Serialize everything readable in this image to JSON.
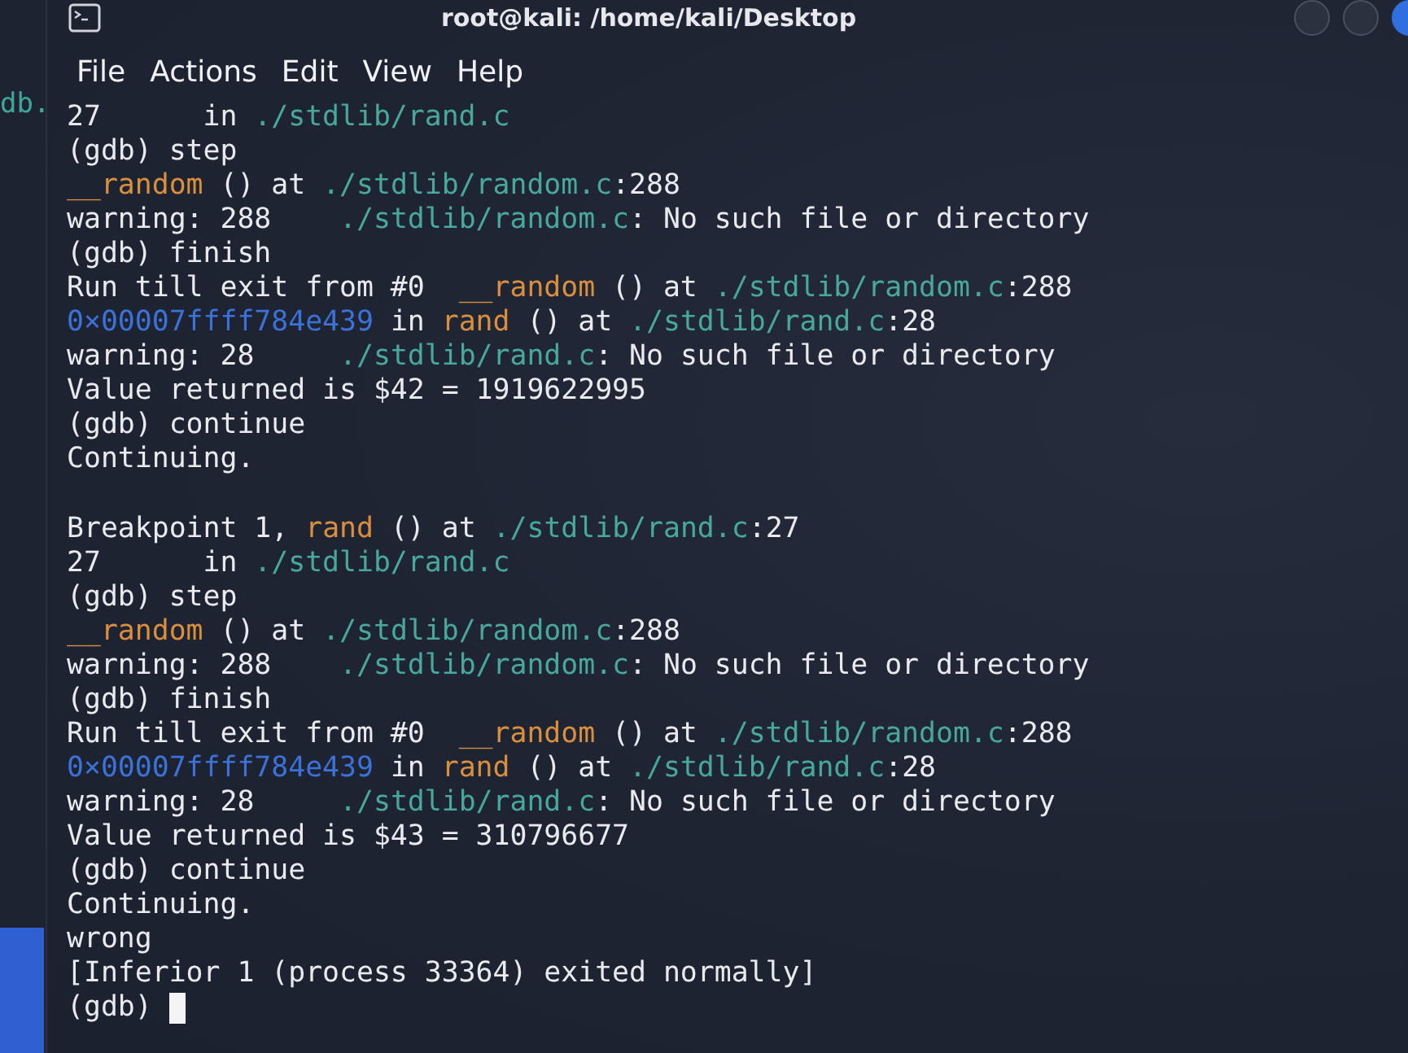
{
  "window": {
    "title": "root@kali: /home/kali/Desktop"
  },
  "background_window": {
    "text": "db."
  },
  "menu": [
    "File",
    "Actions",
    "Edit",
    "View",
    "Help"
  ],
  "terminal": {
    "lines": [
      {
        "kind": "output",
        "segments": [
          {
            "kind": "text",
            "text": "27      in "
          },
          {
            "kind": "path",
            "text": "./stdlib/rand.c"
          }
        ]
      },
      {
        "kind": "output",
        "segments": [
          {
            "kind": "text",
            "text": "(gdb) step"
          }
        ]
      },
      {
        "kind": "output",
        "segments": [
          {
            "kind": "func",
            "text": "__random"
          },
          {
            "kind": "text",
            "text": " () at "
          },
          {
            "kind": "path",
            "text": "./stdlib/random.c"
          },
          {
            "kind": "text",
            "text": ":288"
          }
        ]
      },
      {
        "kind": "output",
        "segments": [
          {
            "kind": "text",
            "text": "warning: 288    "
          },
          {
            "kind": "path",
            "text": "./stdlib/random.c"
          },
          {
            "kind": "text",
            "text": ": No such file or directory"
          }
        ]
      },
      {
        "kind": "output",
        "segments": [
          {
            "kind": "text",
            "text": "(gdb) finish"
          }
        ]
      },
      {
        "kind": "output",
        "segments": [
          {
            "kind": "text",
            "text": "Run till exit from #0  "
          },
          {
            "kind": "func",
            "text": "__random"
          },
          {
            "kind": "text",
            "text": " () at "
          },
          {
            "kind": "path",
            "text": "./stdlib/random.c"
          },
          {
            "kind": "text",
            "text": ":288"
          }
        ]
      },
      {
        "kind": "output",
        "segments": [
          {
            "kind": "addr",
            "text": "0×00007ffff784e439"
          },
          {
            "kind": "text",
            "text": " in "
          },
          {
            "kind": "func",
            "text": "rand"
          },
          {
            "kind": "text",
            "text": " () at "
          },
          {
            "kind": "path",
            "text": "./stdlib/rand.c"
          },
          {
            "kind": "text",
            "text": ":28"
          }
        ]
      },
      {
        "kind": "output",
        "segments": [
          {
            "kind": "text",
            "text": "warning: 28     "
          },
          {
            "kind": "path",
            "text": "./stdlib/rand.c"
          },
          {
            "kind": "text",
            "text": ": No such file or directory"
          }
        ]
      },
      {
        "kind": "output",
        "segments": [
          {
            "kind": "text",
            "text": "Value returned is $42 = 1919622995"
          }
        ]
      },
      {
        "kind": "output",
        "segments": [
          {
            "kind": "text",
            "text": "(gdb) continue"
          }
        ]
      },
      {
        "kind": "output",
        "segments": [
          {
            "kind": "text",
            "text": "Continuing."
          }
        ]
      },
      {
        "kind": "blank"
      },
      {
        "kind": "output",
        "segments": [
          {
            "kind": "text",
            "text": "Breakpoint 1, "
          },
          {
            "kind": "func",
            "text": "rand"
          },
          {
            "kind": "text",
            "text": " () at "
          },
          {
            "kind": "path",
            "text": "./stdlib/rand.c"
          },
          {
            "kind": "text",
            "text": ":27"
          }
        ]
      },
      {
        "kind": "output",
        "segments": [
          {
            "kind": "text",
            "text": "27      in "
          },
          {
            "kind": "path",
            "text": "./stdlib/rand.c"
          }
        ]
      },
      {
        "kind": "output",
        "segments": [
          {
            "kind": "text",
            "text": "(gdb) step"
          }
        ]
      },
      {
        "kind": "output",
        "segments": [
          {
            "kind": "func",
            "text": "__random"
          },
          {
            "kind": "text",
            "text": " () at "
          },
          {
            "kind": "path",
            "text": "./stdlib/random.c"
          },
          {
            "kind": "text",
            "text": ":288"
          }
        ]
      },
      {
        "kind": "output",
        "segments": [
          {
            "kind": "text",
            "text": "warning: 288    "
          },
          {
            "kind": "path",
            "text": "./stdlib/random.c"
          },
          {
            "kind": "text",
            "text": ": No such file or directory"
          }
        ]
      },
      {
        "kind": "output",
        "segments": [
          {
            "kind": "text",
            "text": "(gdb) finish"
          }
        ]
      },
      {
        "kind": "output",
        "segments": [
          {
            "kind": "text",
            "text": "Run till exit from #0  "
          },
          {
            "kind": "func",
            "text": "__random"
          },
          {
            "kind": "text",
            "text": " () at "
          },
          {
            "kind": "path",
            "text": "./stdlib/random.c"
          },
          {
            "kind": "text",
            "text": ":288"
          }
        ]
      },
      {
        "kind": "output",
        "segments": [
          {
            "kind": "addr",
            "text": "0×00007ffff784e439"
          },
          {
            "kind": "text",
            "text": " in "
          },
          {
            "kind": "func",
            "text": "rand"
          },
          {
            "kind": "text",
            "text": " () at "
          },
          {
            "kind": "path",
            "text": "./stdlib/rand.c"
          },
          {
            "kind": "text",
            "text": ":28"
          }
        ]
      },
      {
        "kind": "output",
        "segments": [
          {
            "kind": "text",
            "text": "warning: 28     "
          },
          {
            "kind": "path",
            "text": "./stdlib/rand.c"
          },
          {
            "kind": "text",
            "text": ": No such file or directory"
          }
        ]
      },
      {
        "kind": "output",
        "segments": [
          {
            "kind": "text",
            "text": "Value returned is $43 = 310796677"
          }
        ]
      },
      {
        "kind": "output",
        "segments": [
          {
            "kind": "text",
            "text": "(gdb) continue"
          }
        ]
      },
      {
        "kind": "output",
        "segments": [
          {
            "kind": "text",
            "text": "Continuing."
          }
        ]
      },
      {
        "kind": "output",
        "segments": [
          {
            "kind": "text",
            "text": "wrong"
          }
        ]
      },
      {
        "kind": "output",
        "segments": [
          {
            "kind": "text",
            "text": "[Inferior 1 (process 33364) exited normally]"
          }
        ]
      },
      {
        "kind": "prompt",
        "segments": [
          {
            "kind": "text",
            "text": "(gdb) "
          }
        ]
      }
    ]
  }
}
